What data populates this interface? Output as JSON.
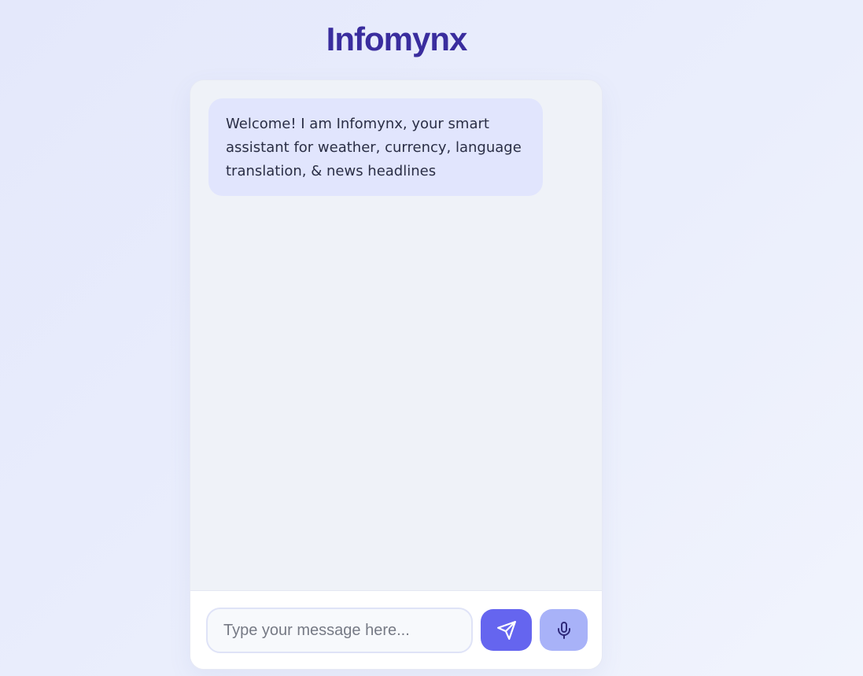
{
  "header": {
    "title": "Infomynx"
  },
  "chat": {
    "messages": [
      {
        "sender": "bot",
        "text": "Welcome! I am Infomynx, your smart assistant for weather, currency, language translation, & news headlines"
      }
    ]
  },
  "composer": {
    "placeholder": "Type your message here...",
    "value": "",
    "send_icon": "send-icon",
    "mic_icon": "microphone-icon"
  },
  "colors": {
    "title": "#3a2d9e",
    "bot_bubble": "#e1e5fd",
    "send_button": "#6565ef",
    "mic_button": "#a8b2f8"
  }
}
